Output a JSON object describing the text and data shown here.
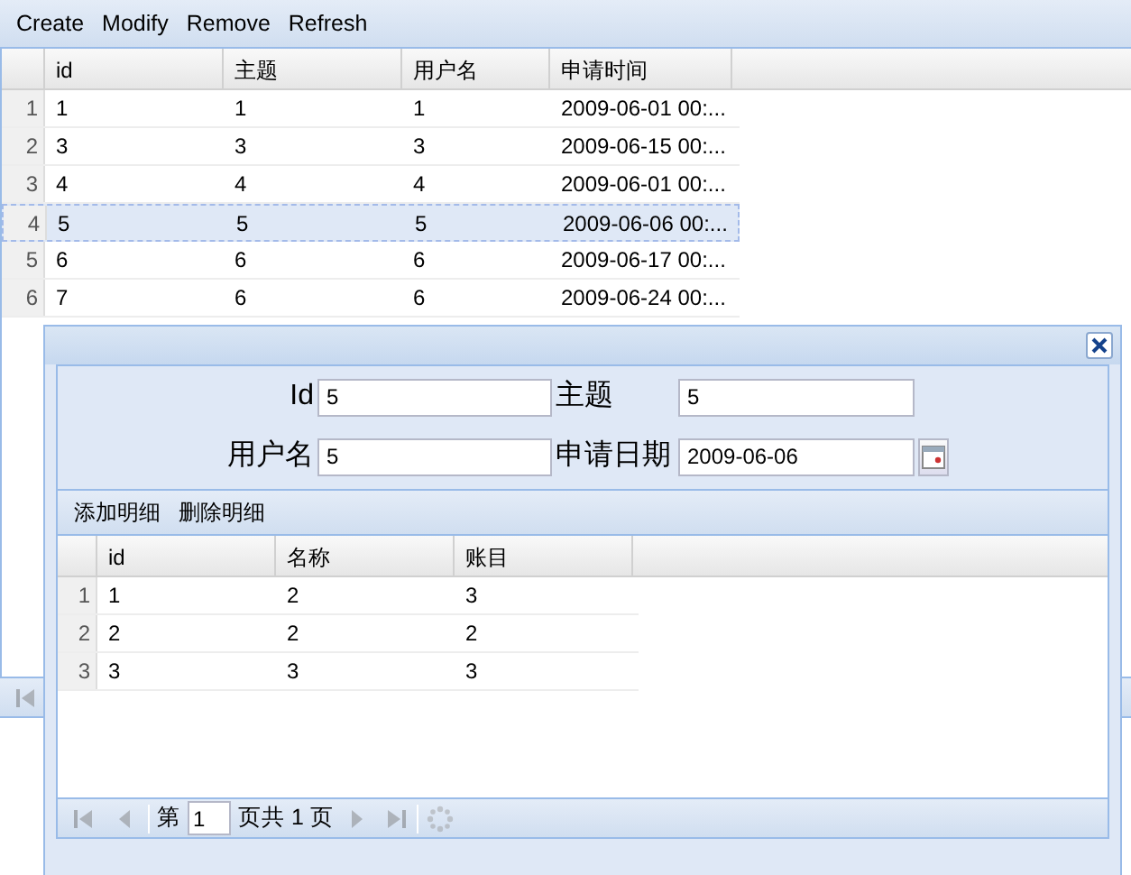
{
  "toolbar": [
    "Create",
    "Modify",
    "Remove",
    "Refresh"
  ],
  "grid": {
    "columns": [
      "id",
      "主题",
      "用户名",
      "申请时间"
    ],
    "rows": [
      {
        "num": "1",
        "cells": [
          "1",
          "1",
          "1",
          "2009-06-01 00:..."
        ],
        "selected": false
      },
      {
        "num": "2",
        "cells": [
          "3",
          "3",
          "3",
          "2009-06-15 00:..."
        ],
        "selected": false
      },
      {
        "num": "3",
        "cells": [
          "4",
          "4",
          "4",
          "2009-06-01 00:..."
        ],
        "selected": false
      },
      {
        "num": "4",
        "cells": [
          "5",
          "5",
          "5",
          "2009-06-06 00:..."
        ],
        "selected": true
      },
      {
        "num": "5",
        "cells": [
          "6",
          "6",
          "6",
          "2009-06-17 00:..."
        ],
        "selected": false
      },
      {
        "num": "6",
        "cells": [
          "7",
          "6",
          "6",
          "2009-06-24 00:..."
        ],
        "selected": false
      }
    ],
    "pager": {
      "buttons": [
        {
          "kind": "first",
          "disabled": true
        }
      ]
    }
  },
  "dialog": {
    "form": {
      "fields": [
        {
          "label": "Id",
          "value": "5",
          "kind": "text"
        },
        {
          "label": "主题",
          "value": "5",
          "kind": "text"
        },
        {
          "label": "用户名",
          "value": "5",
          "kind": "text"
        },
        {
          "label": "申请日期",
          "value": "2009-06-06",
          "kind": "date"
        }
      ]
    },
    "detail_toolbar": [
      "添加明细",
      "删除明细"
    ],
    "detail_grid": {
      "columns": [
        "id",
        "名称",
        "账目"
      ],
      "rows": [
        {
          "num": "1",
          "cells": [
            "1",
            "2",
            "3"
          ],
          "selected": false
        },
        {
          "num": "2",
          "cells": [
            "2",
            "2",
            "2"
          ],
          "selected": false
        },
        {
          "num": "3",
          "cells": [
            "3",
            "3",
            "3"
          ],
          "selected": false
        }
      ]
    },
    "pager": {
      "before": "第",
      "page": "1",
      "after": "页共 1 页",
      "buttons": [
        {
          "kind": "first",
          "disabled": true
        },
        {
          "kind": "prev",
          "disabled": true
        },
        {
          "kind": "sep"
        },
        {
          "kind": "next",
          "disabled": true
        },
        {
          "kind": "last",
          "disabled": true
        },
        {
          "kind": "sep"
        },
        {
          "kind": "refresh",
          "disabled": true
        }
      ]
    }
  }
}
